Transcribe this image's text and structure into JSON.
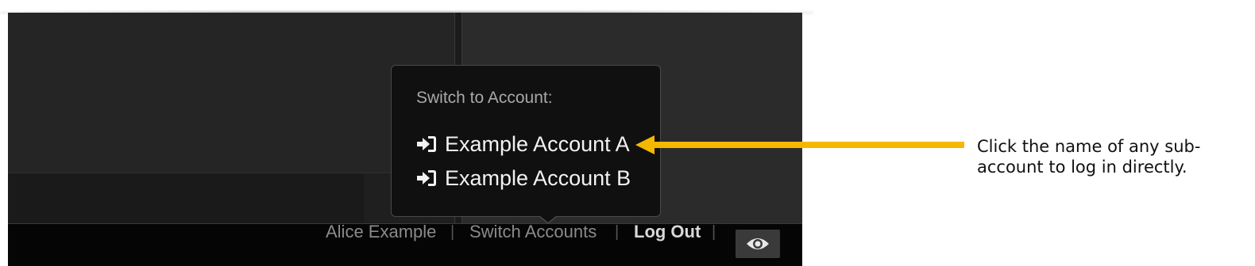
{
  "popover": {
    "title": "Switch to Account:",
    "accounts": [
      {
        "label": "Example Account A",
        "icon": "sign-in-icon"
      },
      {
        "label": "Example Account B",
        "icon": "sign-in-icon"
      }
    ]
  },
  "footer": {
    "user_name": "Alice Example",
    "separator": "|",
    "switch_accounts": "Switch Accounts",
    "log_out": "Log Out",
    "eye_icon": "eye-icon"
  },
  "annotation": {
    "text": "Click the name of any sub-account to log in directly.",
    "arrow_color": "#f5b800"
  },
  "colors": {
    "app_background": "#242424",
    "footer_background": "#050505",
    "popover_background": "#101010",
    "accent_arrow": "#f5b800"
  }
}
